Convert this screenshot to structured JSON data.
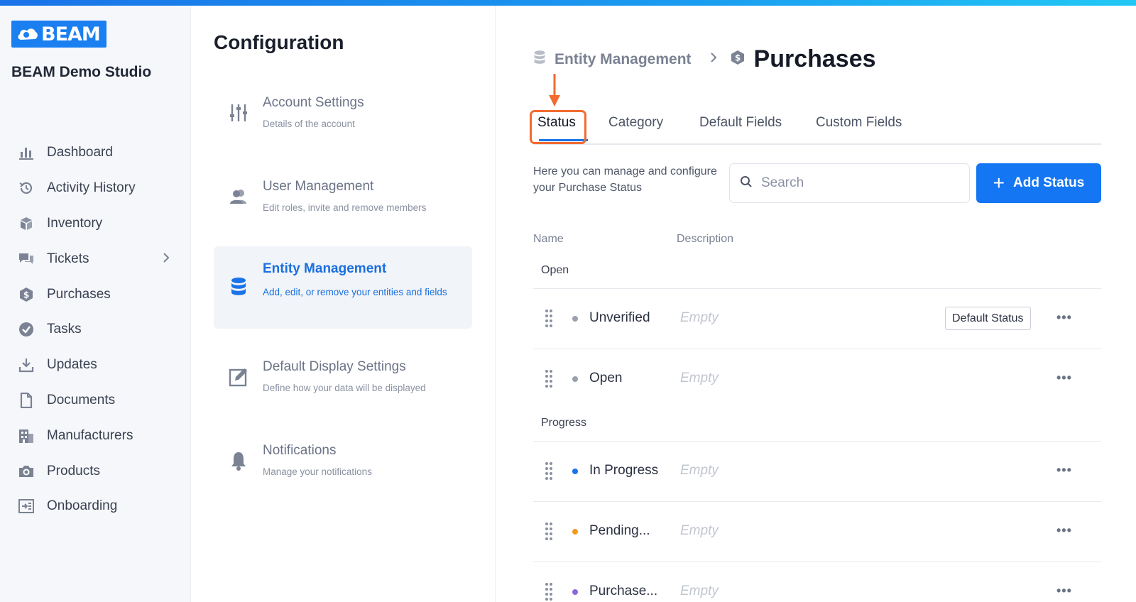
{
  "brand": {
    "logo_text": "BEAM",
    "studio_name": "BEAM Demo Studio"
  },
  "sidebar": {
    "items": [
      {
        "label": "Dashboard",
        "icon": "bar-chart-icon"
      },
      {
        "label": "Activity History",
        "icon": "history-icon"
      },
      {
        "label": "Inventory",
        "icon": "cube-icon"
      },
      {
        "label": "Tickets",
        "icon": "chat-icon"
      },
      {
        "label": "Purchases",
        "icon": "dollar-shield-icon"
      },
      {
        "label": "Tasks",
        "icon": "check-circle-icon"
      },
      {
        "label": "Updates",
        "icon": "download-icon"
      },
      {
        "label": "Documents",
        "icon": "document-icon"
      },
      {
        "label": "Manufacturers",
        "icon": "building-icon"
      },
      {
        "label": "Products",
        "icon": "camera-icon"
      },
      {
        "label": "Onboarding",
        "icon": "onboarding-icon"
      }
    ]
  },
  "config": {
    "title": "Configuration",
    "items": [
      {
        "title": "Account Settings",
        "desc": "Details of the account",
        "icon": "sliders-icon"
      },
      {
        "title": "User Management",
        "desc": "Edit roles, invite and remove members",
        "icon": "users-icon"
      },
      {
        "title": "Entity Management",
        "desc": "Add, edit, or remove your entities and fields",
        "icon": "database-icon"
      },
      {
        "title": "Default Display Settings",
        "desc": "Define how your data will be displayed",
        "icon": "edit-icon"
      },
      {
        "title": "Notifications",
        "desc": "Manage your notifications",
        "icon": "bell-icon"
      }
    ]
  },
  "breadcrumb": {
    "parent": "Entity Management",
    "current": "Purchases"
  },
  "tabs": [
    "Status",
    "Category",
    "Default Fields",
    "Custom Fields"
  ],
  "main": {
    "description": "Here you can manage and configure your Purchase Status",
    "search_placeholder": "Search",
    "add_button": "Add Status",
    "columns": {
      "name": "Name",
      "description": "Description"
    }
  },
  "groups": [
    {
      "label": "Open"
    },
    {
      "label": "Progress"
    }
  ],
  "statuses": [
    {
      "name": "Unverified",
      "description": "Empty",
      "color": "#9aa0ad",
      "badge": "Default Status"
    },
    {
      "name": "Open",
      "description": "Empty",
      "color": "#9aa0ad"
    },
    {
      "name": "In Progress",
      "description": "Empty",
      "color": "#1a73e8"
    },
    {
      "name": "Pending...",
      "description": "Empty",
      "color": "#f29a1f"
    },
    {
      "name": "Purchase...",
      "description": "Empty",
      "color": "#8a6ad8"
    }
  ],
  "more_label": "•••",
  "colors": {
    "accent": "#1476f2",
    "highlight": "#f26b2f"
  }
}
